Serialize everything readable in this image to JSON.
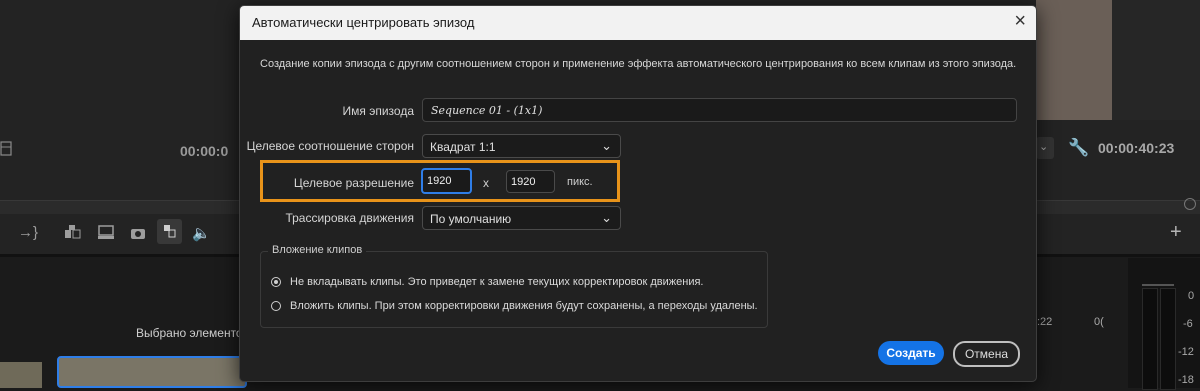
{
  "background": {
    "timecode_left": "00:00:0",
    "timecode_right": "00:00:40:23",
    "selected_label": "Выбрано элементов",
    "ruler_marks": [
      ":22",
      "0("
    ],
    "meter_labels": [
      "0",
      "-6",
      "-12",
      "-18"
    ],
    "icons": [
      "insert-icon",
      "overwrite-icon",
      "export-frame-icon",
      "camera-icon",
      "compare-icon",
      "speaker-icon",
      "wrench-icon",
      "plus-icon"
    ]
  },
  "dialog": {
    "title": "Автоматически центрировать эпизод",
    "description": "Создание копии эпизода с другим соотношением сторон и применение эффекта автоматического центрирования ко всем клипам из этого эпизода.",
    "sequence_name": {
      "label": "Имя эпизода",
      "value": "Sequence 01 - (1x1)"
    },
    "aspect_ratio": {
      "label": "Целевое соотношение сторон",
      "value": "Квадрат 1:1"
    },
    "resolution": {
      "label": "Целевое разрешение",
      "width": "1920",
      "separator": "x",
      "height": "1920",
      "unit": "пикс."
    },
    "motion_tracking": {
      "label": "Трассировка движения",
      "value": "По умолчанию"
    },
    "nesting": {
      "legend": "Вложение клипов",
      "options": [
        {
          "label": "Не вкладывать клипы. Это приведет к замене текущих корректировок движения.",
          "checked": true
        },
        {
          "label": "Вложить клипы. При этом корректировки движения будут сохранены, а переходы удалены.",
          "checked": false
        }
      ]
    },
    "create_label": "Создать",
    "cancel_label": "Отмена"
  },
  "colors": {
    "accent": "#1473e6",
    "highlight": "#e8931a",
    "focus": "#2f7ee8"
  }
}
